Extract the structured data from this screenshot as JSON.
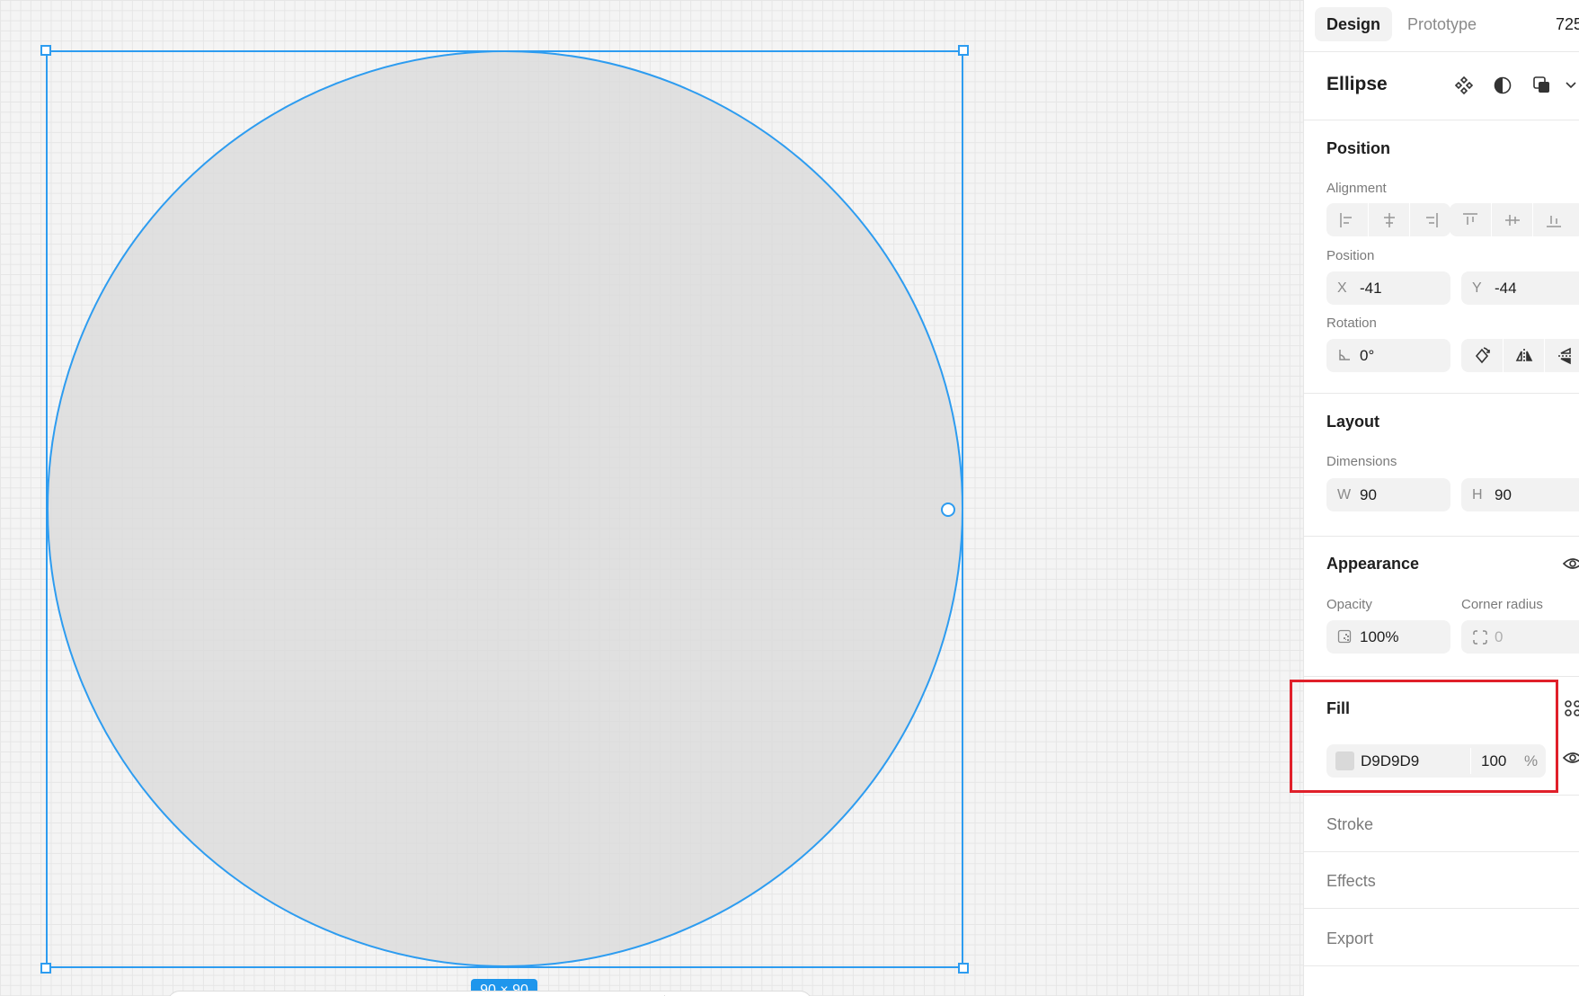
{
  "canvas": {
    "size_badge": "90 × 90"
  },
  "panel": {
    "tabs": [
      {
        "label": "Design",
        "active": true
      },
      {
        "label": "Prototype",
        "active": false
      }
    ],
    "zoom": "725",
    "layer_title": "Ellipse",
    "layer_icons": [
      "component-icon",
      "mask-icon",
      "boolean-icon",
      "chevron-down-icon"
    ],
    "position": {
      "title": "Position",
      "alignment_label": "Alignment",
      "position_label": "Position",
      "x_prefix": "X",
      "x_value": "-41",
      "y_prefix": "Y",
      "y_value": "-44",
      "rotation_label": "Rotation",
      "rotation_value": "0°"
    },
    "layout": {
      "title": "Layout",
      "dimensions_label": "Dimensions",
      "w_prefix": "W",
      "w_value": "90",
      "h_prefix": "H",
      "h_value": "90"
    },
    "appearance": {
      "title": "Appearance",
      "opacity_label": "Opacity",
      "opacity_value": "100%",
      "corner_radius_label": "Corner radius",
      "corner_radius_value": "0"
    },
    "fill": {
      "title": "Fill",
      "hex": "D9D9D9",
      "swatch_color": "#D9D9D9",
      "opacity": "100",
      "opacity_unit": "%"
    },
    "stroke_title": "Stroke",
    "effects_title": "Effects",
    "export_title": "Export"
  },
  "colors": {
    "selection": "#2d9cf0",
    "highlight": "#e0202a"
  }
}
